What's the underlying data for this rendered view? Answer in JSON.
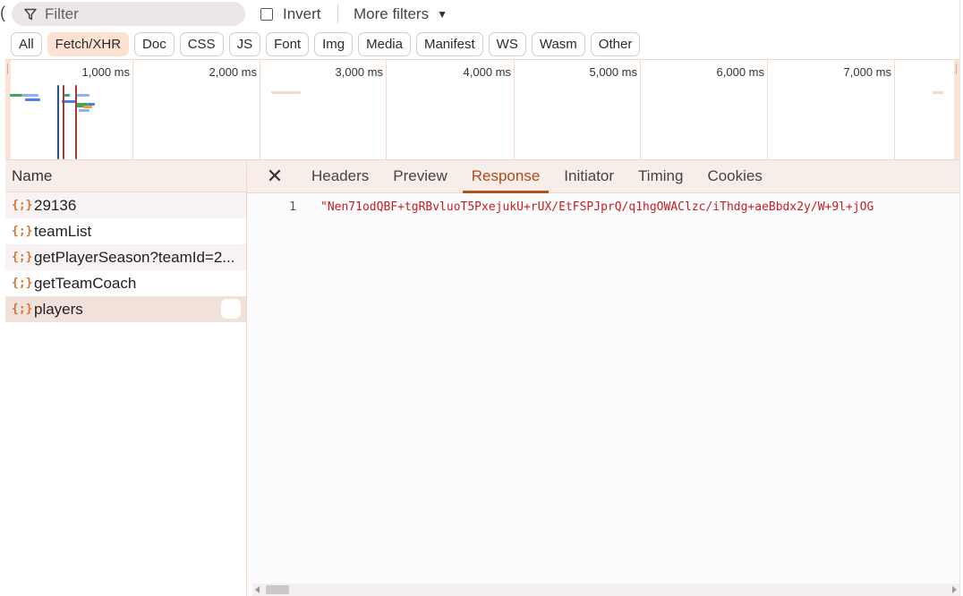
{
  "filter": {
    "placeholder": "Filter",
    "invert_label": "Invert",
    "more_filters_label": "More filters"
  },
  "chips": [
    {
      "label": "All",
      "active": false
    },
    {
      "label": "Fetch/XHR",
      "active": true
    },
    {
      "label": "Doc",
      "active": false
    },
    {
      "label": "CSS",
      "active": false
    },
    {
      "label": "JS",
      "active": false
    },
    {
      "label": "Font",
      "active": false
    },
    {
      "label": "Img",
      "active": false
    },
    {
      "label": "Media",
      "active": false
    },
    {
      "label": "Manifest",
      "active": false
    },
    {
      "label": "WS",
      "active": false
    },
    {
      "label": "Wasm",
      "active": false
    },
    {
      "label": "Other",
      "active": false
    }
  ],
  "timeline": {
    "ticks": [
      "1,000 ms",
      "2,000 ms",
      "3,000 ms",
      "4,000 ms",
      "5,000 ms",
      "6,000 ms",
      "7,000 ms"
    ],
    "colors": {
      "blue": "#4a80e8",
      "green": "#3fa757",
      "orange": "#f0a040",
      "red_line": "#a33a3a",
      "blue_line": "#2a4f9a"
    }
  },
  "requests": {
    "header": "Name",
    "items": [
      {
        "name": "29136",
        "icon": "json-braces-icon"
      },
      {
        "name": "teamList",
        "icon": "json-braces-icon"
      },
      {
        "name": "getPlayerSeason?teamId=2...",
        "icon": "json-braces-icon"
      },
      {
        "name": "getTeamCoach",
        "icon": "json-braces-icon"
      },
      {
        "name": "players",
        "icon": "json-braces-icon",
        "selected": true
      }
    ]
  },
  "detail": {
    "tabs": [
      "Headers",
      "Preview",
      "Response",
      "Initiator",
      "Timing",
      "Cookies"
    ],
    "active_tab": "Response",
    "lines": [
      {
        "num": "1",
        "text": "\"Nen71odQBF+tgRBvluoT5PxejukU+rUX/EtFSPJprQ/q1hgOWAClzc/iThdg+aeBbdx2y/W+9l+jOG"
      }
    ]
  },
  "colors": {
    "accent": "#b0541f",
    "active_chip_bg": "#fde1d3",
    "response_text": "#c81e1e"
  }
}
